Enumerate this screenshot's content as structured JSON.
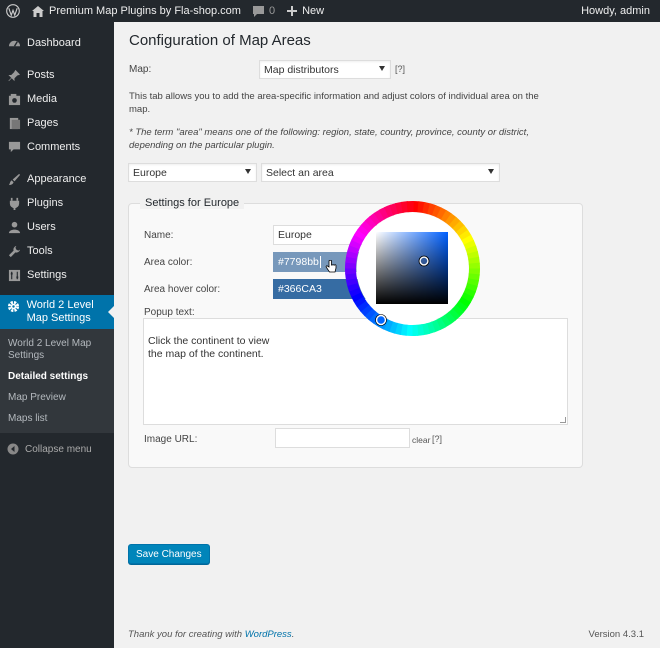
{
  "adminbar": {
    "site_name": "Premium Map Plugins by Fla-shop.com",
    "comments_count": "0",
    "new_label": "New",
    "howdy": "Howdy, admin"
  },
  "sidebar": {
    "items": [
      {
        "label": "Dashboard",
        "icon": "dashboard-icon"
      },
      {
        "label": "Posts",
        "icon": "pin-icon"
      },
      {
        "label": "Media",
        "icon": "media-icon"
      },
      {
        "label": "Pages",
        "icon": "pages-icon"
      },
      {
        "label": "Comments",
        "icon": "comments-icon"
      },
      {
        "label": "Appearance",
        "icon": "brush-icon"
      },
      {
        "label": "Plugins",
        "icon": "plugin-icon"
      },
      {
        "label": "Users",
        "icon": "users-icon"
      },
      {
        "label": "Tools",
        "icon": "wrench-icon"
      },
      {
        "label": "Settings",
        "icon": "settings-icon"
      }
    ],
    "current": {
      "label": "World 2 Level Map Settings",
      "icon": "gear-icon"
    },
    "submenu": [
      "World 2 Level Map Settings",
      "Detailed settings",
      "Map Preview",
      "Maps list"
    ],
    "collapse": "Collapse menu"
  },
  "main": {
    "title": "Configuration of Map Areas",
    "map_label": "Map:",
    "map_select": "Map distributors",
    "help": "[?]",
    "intro": "This tab allows you to add the area-specific information and adjust colors of individual area on the map.",
    "note": "* The term \"area\" means one of the following: region, state, country, province, county or district, depending on the particular plugin.",
    "region_select": "Europe",
    "area_select": "Select an area",
    "panel_title": "Settings for Europe",
    "name_label": "Name:",
    "name_value": "Europe",
    "area_color_label": "Area color:",
    "area_color_value": "#7798bb",
    "hover_color_label": "Area hover color:",
    "hover_color_value": "#366CA3",
    "popup_label": "Popup text:",
    "popup_value": "Click the continent to view\nthe map of the continent.",
    "image_url_label": "Image URL:",
    "image_url_value": "",
    "clear_label": "clear",
    "save_label": "Save Changes",
    "footer_prefix": "Thank you for creating with ",
    "footer_link": "WordPress",
    "footer_suffix": ".",
    "version": "Version 4.3.1"
  },
  "colors": {
    "adminbar": "#23282d",
    "sidebar_current": "#0073aa",
    "area_color": "#7798bb",
    "hover_color": "#366ca3",
    "button": "#0085ba"
  }
}
